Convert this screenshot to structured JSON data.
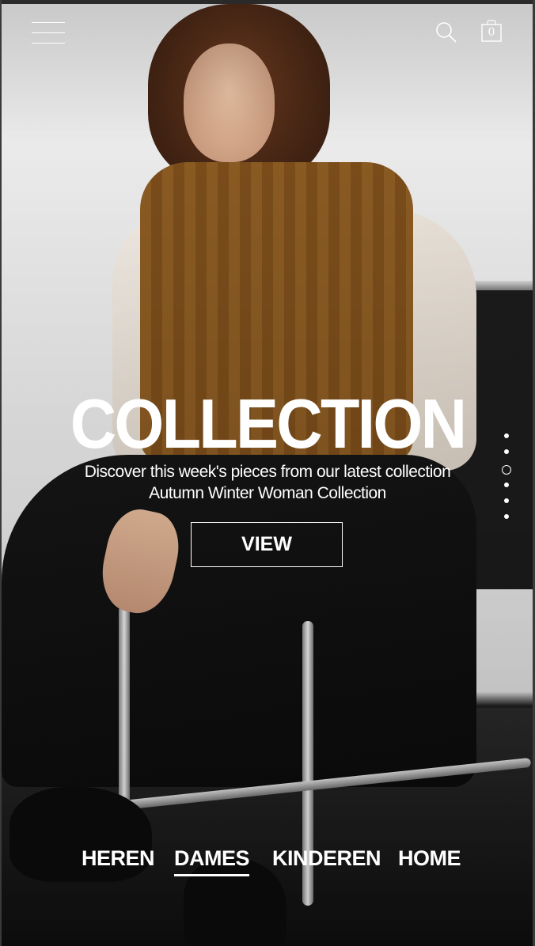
{
  "header": {
    "menu_icon": "hamburger-menu-icon",
    "search_icon": "search-icon",
    "cart_icon": "shopping-bag-icon",
    "cart_count": "0"
  },
  "hero": {
    "title": "COLLECTION",
    "subtitle_line1": "Discover this week's pieces from our latest collection",
    "subtitle_line2": "Autumn Winter Woman Collection",
    "cta_label": "VIEW"
  },
  "slider": {
    "total_slides": 6,
    "active_slide": 3
  },
  "bottom_nav": {
    "items": [
      {
        "label": "HEREN"
      },
      {
        "label": "DAMES"
      },
      {
        "label": "KINDEREN"
      },
      {
        "label": "HOME"
      }
    ],
    "active": "DAMES"
  },
  "colors": {
    "text": "#ffffff",
    "vest": "#8a5a22",
    "background_wall": "#ececec"
  }
}
